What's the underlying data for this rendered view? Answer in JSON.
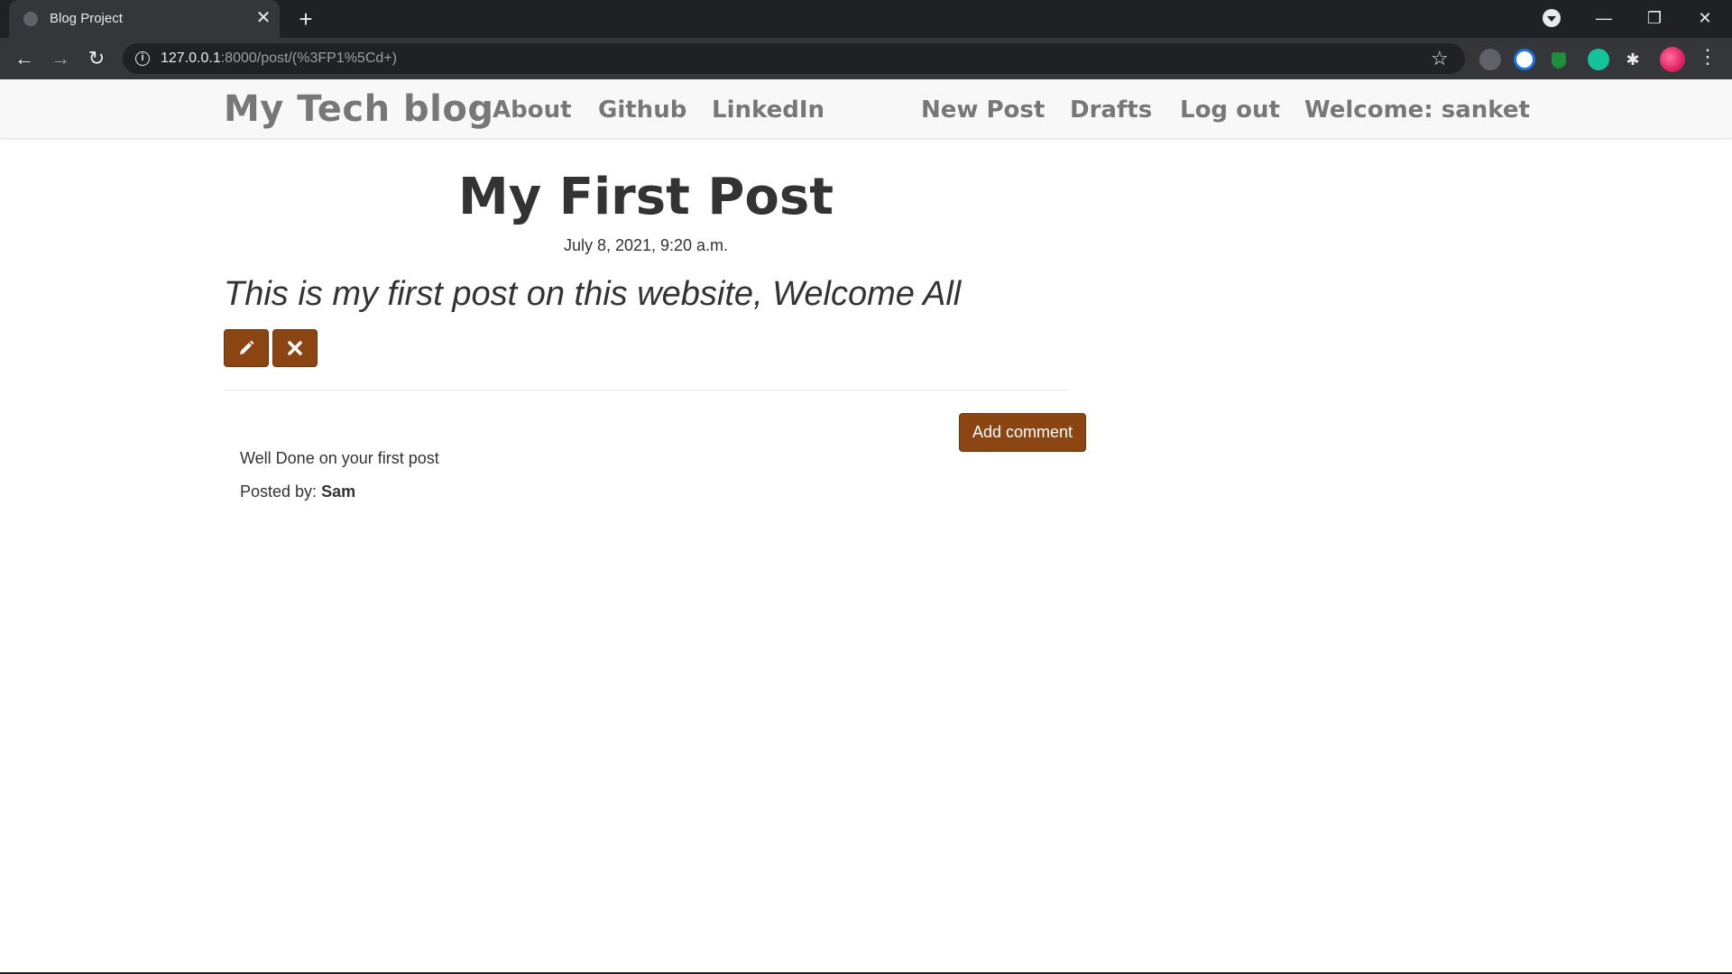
{
  "browser": {
    "tab_title": "Blog Project",
    "tab_close": "✕",
    "new_tab": "+",
    "url_host": "127.0.0.1",
    "url_rest": ":8000/post/(%3FP1%5Cd+)",
    "controls": {
      "minimize": "—",
      "restore": "❐",
      "close": "✕"
    }
  },
  "nav": {
    "brand": "My Tech blog",
    "links_left": [
      "About",
      "Github",
      "LinkedIn"
    ],
    "links_right": [
      "New Post",
      "Drafts",
      "Log out",
      "Welcome: sanket"
    ]
  },
  "post": {
    "title": "My First Post",
    "date": "July 8, 2021, 9:20 a.m.",
    "body": "This is my first post on this website, Welcome All"
  },
  "actions": {
    "edit_icon": "pencil-icon",
    "delete_icon": "remove-icon",
    "add_comment": "Add comment"
  },
  "comments": [
    {
      "text": "Well Done on your first post",
      "posted_by_label": "Posted by:",
      "author": "Sam"
    }
  ],
  "colors": {
    "accent": "#8b4513",
    "nav_text": "#777777",
    "chrome_dark": "#202124",
    "chrome_toolbar": "#35363a"
  }
}
